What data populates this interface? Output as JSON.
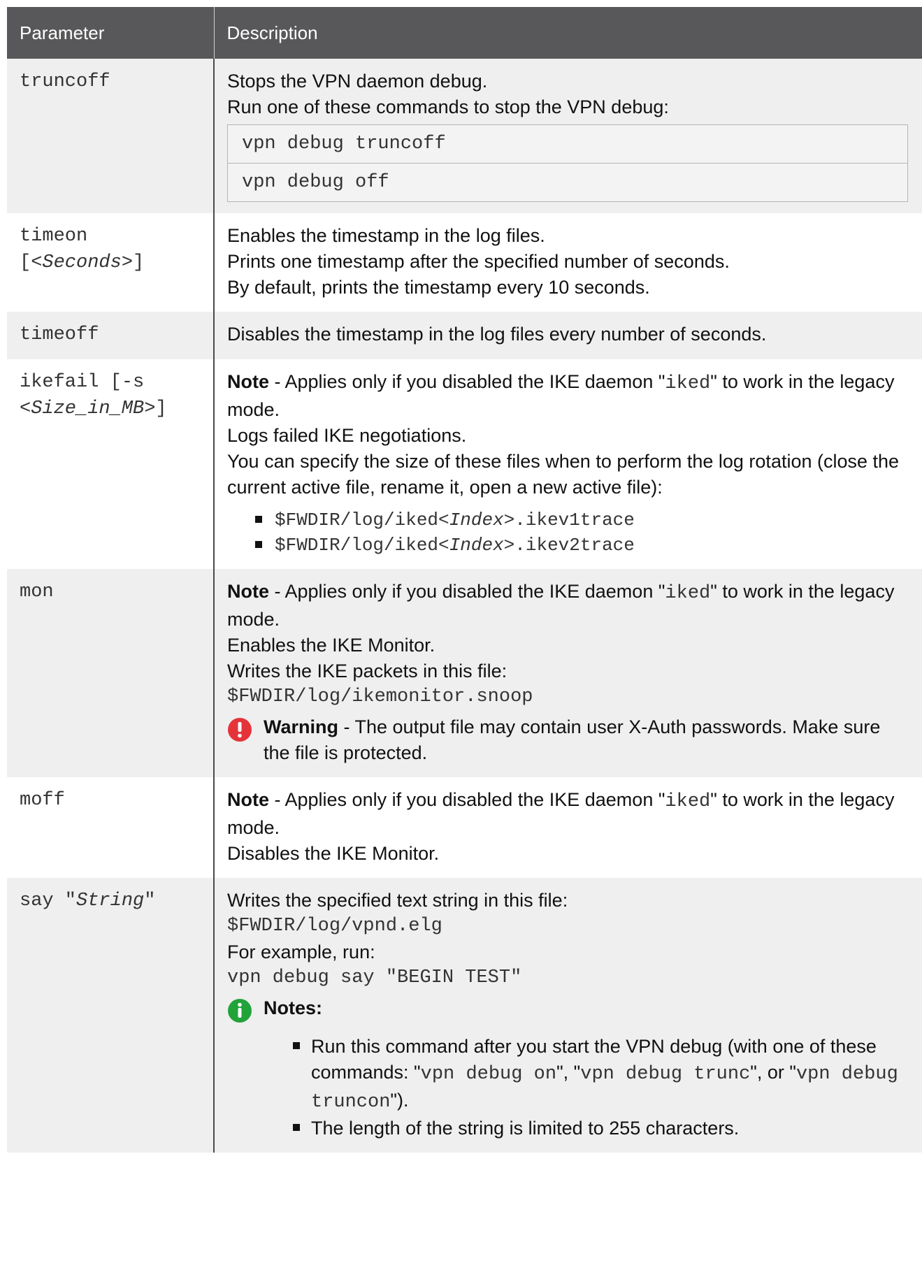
{
  "header": {
    "parameter": "Parameter",
    "description": "Description"
  },
  "rows": {
    "truncoff": {
      "param": "truncoff",
      "line1": "Stops the VPN daemon debug.",
      "line2": "Run one of these commands to stop the VPN debug:",
      "commands": [
        "vpn debug truncoff",
        "vpn debug off"
      ]
    },
    "timeon": {
      "param_a": "timeon",
      "param_b1": "[<",
      "param_b2": "Seconds",
      "param_b3": ">]",
      "line1": "Enables the timestamp in the log files.",
      "line2": "Prints one timestamp after the specified number of seconds.",
      "line3": "By default, prints the timestamp every 10 seconds."
    },
    "timeoff": {
      "param": "timeoff",
      "line1": "Disables the timestamp in the log files every number of seconds."
    },
    "ikefail": {
      "param_a": "ikefail [-s",
      "param_b1": "<",
      "param_b2": "Size_in_MB",
      "param_b3": ">]",
      "note_label": "Note",
      "note_pre": " - Applies only if you disabled the IKE daemon \"",
      "note_code": "iked",
      "note_post": "\" to work in the legacy mode.",
      "line1": "Logs failed IKE negotiations.",
      "line2": "You can specify the size of these files when to perform the log rotation (close the current active file, rename it, open a new active file):",
      "files": [
        {
          "pre": "$FWDIR/log/iked<",
          "ital": "Index",
          "post": ">.ikev1trace"
        },
        {
          "pre": "$FWDIR/log/iked<",
          "ital": "Index",
          "post": ">.ikev2trace"
        }
      ]
    },
    "mon": {
      "param": "mon",
      "note_label": "Note",
      "note_pre": " - Applies only if you disabled the IKE daemon \"",
      "note_code": "iked",
      "note_post": "\" to work in the legacy mode.",
      "line1": "Enables the IKE Monitor.",
      "line2": "Writes the IKE packets in this file:",
      "path": "$FWDIR/log/ikemonitor.snoop",
      "warning_label": "Warning",
      "warning_text": " - The output file may contain user X-Auth passwords. Make sure the file is protected."
    },
    "moff": {
      "param": "moff",
      "note_label": "Note",
      "note_pre": " - Applies only if you disabled the IKE daemon \"",
      "note_code": "iked",
      "note_post": "\" to work in the legacy mode.",
      "line1": "Disables the IKE Monitor."
    },
    "say": {
      "param_a": "say \"",
      "param_b": "String",
      "param_c": "\"",
      "line1": "Writes the specified text string in this file:",
      "path": "$FWDIR/log/vpnd.elg",
      "line2": "For example, run:",
      "example": "vpn debug say \"BEGIN TEST\"",
      "notes_label": "Notes:",
      "note1_pre": "Run this command after you start the VPN debug (with one of these commands: \"",
      "note1_c1": "vpn debug on",
      "note1_mid1": "\", \"",
      "note1_c2": "vpn debug trunc",
      "note1_mid2": "\", or \"",
      "note1_c3": "vpn debug truncon",
      "note1_post": "\").",
      "note2": "The length of the string is limited to 255 characters."
    }
  },
  "colors": {
    "header_bg": "#58585a",
    "stripe_bg": "#efefef",
    "warning_red": "#e5333a",
    "info_green": "#22a33a"
  }
}
